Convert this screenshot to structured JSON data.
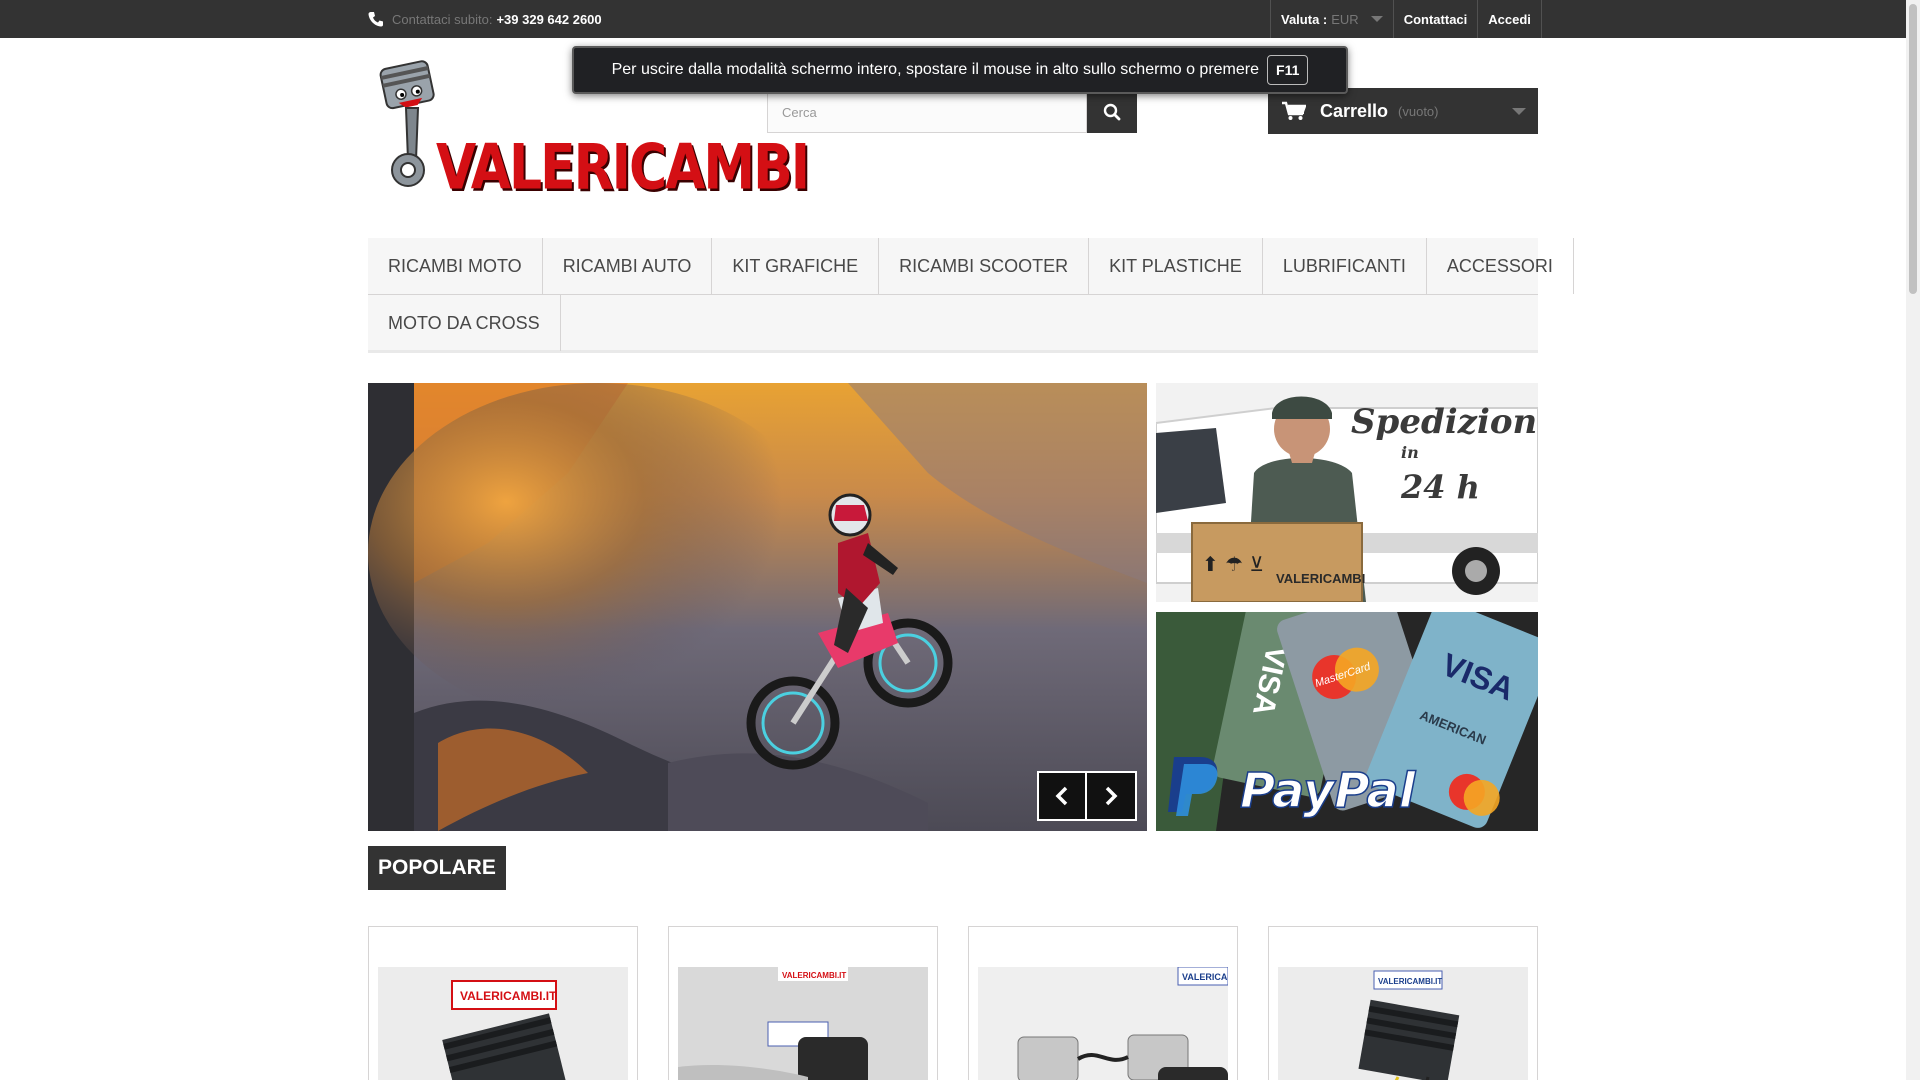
{
  "topbar": {
    "contact_label": "Contattaci subito:",
    "phone": "+39 329 642 2600",
    "currency_label": "Valuta :",
    "currency_value": "EUR",
    "contact_link": "Contattaci",
    "login_link": "Accedi"
  },
  "fullscreen_notice": {
    "text": "Per uscire dalla modalità schermo intero, spostare il mouse in alto sullo schermo o premere",
    "key": "F11"
  },
  "logo": {
    "text": "VALERICAMBI"
  },
  "search": {
    "placeholder": "Cerca",
    "value": ""
  },
  "cart": {
    "label": "Carrello",
    "status": "(vuoto)"
  },
  "menu": {
    "row1": [
      "RICAMBI MOTO",
      "RICAMBI AUTO",
      "KIT GRAFICHE",
      "RICAMBI SCOOTER",
      "KIT PLASTICHE",
      "LUBRIFICANTI",
      "ACCESSORI"
    ],
    "row2": [
      "MOTO DA CROSS"
    ]
  },
  "banners": {
    "shipping": {
      "line1": "Spedizioni",
      "line2": "in",
      "line3": "24 h",
      "box_text": "VALERICAMBI"
    },
    "payment": {
      "brand": "PayPal",
      "card1": "VISA",
      "card2": "VISA",
      "card3": "MasterCard",
      "card4": "AMERICAN"
    }
  },
  "section_title": "POPOLARE",
  "products": [
    {
      "watermark": "VALERICAMBI.IT"
    },
    {
      "watermark": "VALERICAMBI.IT"
    },
    {
      "watermark": "VALERICAMBI.IT"
    },
    {
      "watermark": "VALERICAMBI.IT"
    }
  ],
  "colors": {
    "dark": "#333333",
    "brand_red": "#d40f14",
    "menu_bg": "#f6f6f6"
  }
}
